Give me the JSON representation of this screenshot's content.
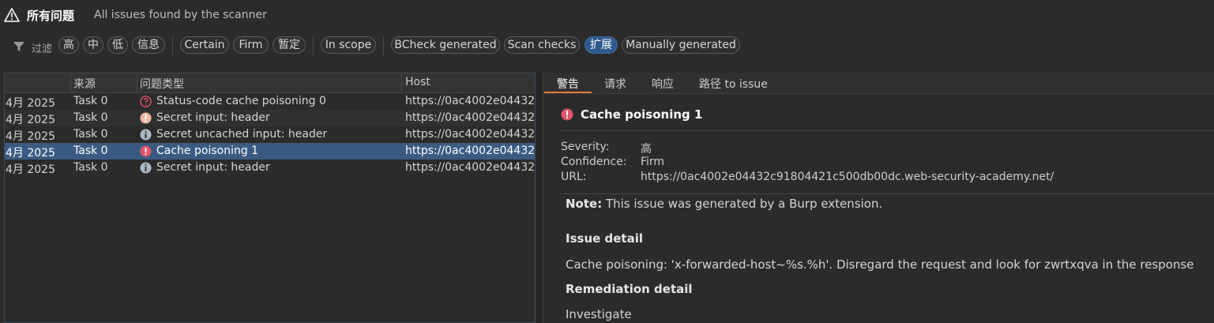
{
  "header": {
    "title": "所有问题",
    "subtitle": "All issues found by the scanner"
  },
  "filter": {
    "label": "过滤",
    "severity_chips": [
      "高",
      "中",
      "低",
      "信息"
    ],
    "confidence_chips": [
      "Certain",
      "Firm",
      "暂定"
    ],
    "scope_chip": "In scope",
    "source_chips": [
      "BCheck generated",
      "Scan checks",
      "扩展",
      "Manually generated"
    ],
    "active_chip": "扩展"
  },
  "table": {
    "columns": [
      "来源",
      "问题类型",
      "Host"
    ],
    "rows": [
      {
        "time": "4月 2025",
        "source": "Task 0",
        "type": "Status-code cache poisoning 0",
        "host": "https://0ac4002e04432...",
        "icon": "question-icon",
        "selected": false
      },
      {
        "time": "4月 2025",
        "source": "Task 0",
        "type": "Secret input: header",
        "host": "https://0ac4002e04432...",
        "icon": "exclamation-icon",
        "selected": false
      },
      {
        "time": "4月 2025",
        "source": "Task 0",
        "type": "Secret uncached input: header",
        "host": "https://0ac4002e04432...",
        "icon": "info-icon",
        "selected": false
      },
      {
        "time": "4月 2025",
        "source": "Task 0",
        "type": "Cache poisoning 1",
        "host": "https://0ac4002e04432...",
        "icon": "exclamation-icon",
        "selected": true
      },
      {
        "time": "4月 2025",
        "source": "Task 0",
        "type": "Secret input: header",
        "host": "https://0ac4002e04432...",
        "icon": "info-icon",
        "selected": false
      }
    ]
  },
  "detail": {
    "tabs": [
      "警告",
      "请求",
      "响应",
      "路径 to issue"
    ],
    "issue_title": "Cache poisoning 1",
    "severity_label": "Severity:",
    "severity_value": "高",
    "confidence_label": "Confidence:",
    "confidence_value": "Firm",
    "url_label": "URL:",
    "url_value": "https://0ac4002e04432c91804421c500db00dc.web-security-academy.net/",
    "note_bold": "Note:",
    "note_text": " This issue was generated by a Burp extension.",
    "issue_detail_heading": "Issue detail",
    "issue_detail_text": "Cache poisoning: 'x-forwarded-host~%s.%h'. Disregard the request and look for zwrtxqva in the response",
    "remediation_heading": "Remediation detail",
    "remediation_text": "Investigate"
  },
  "colors": {
    "accent_blue": "#2f5a8c",
    "selected_row": "#3a5a82",
    "high_red": "#e0556a",
    "info_gray": "#a9b7c6",
    "tab_underline": "#e07a3a"
  }
}
